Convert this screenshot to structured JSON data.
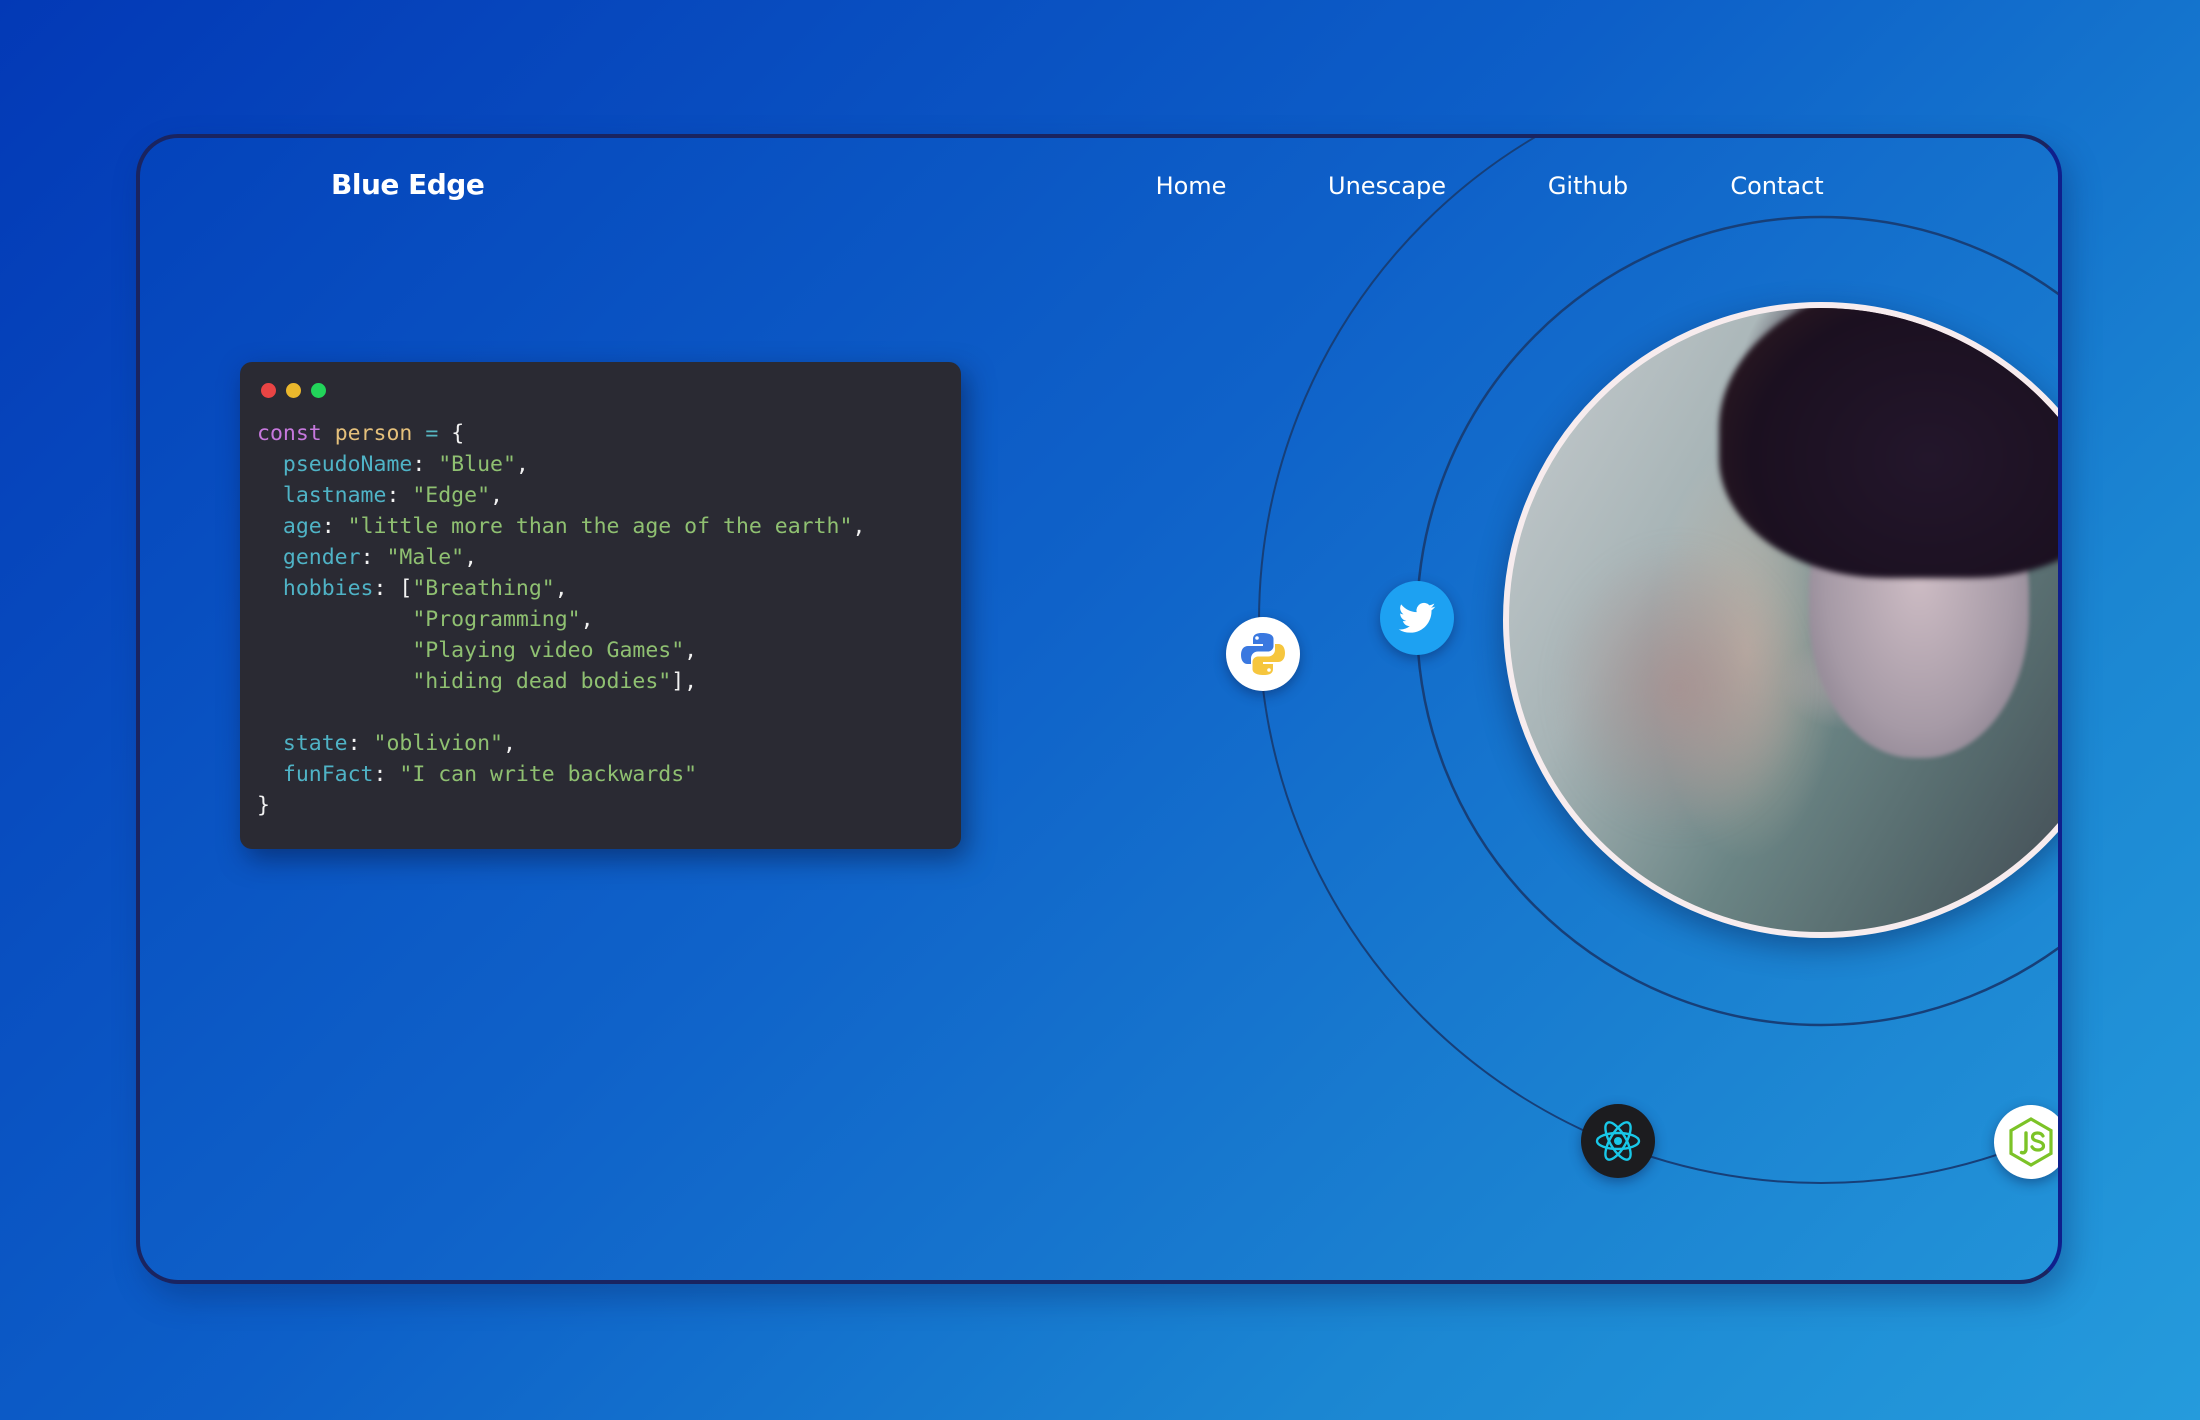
{
  "brand": {
    "name": "Blue Edge"
  },
  "nav": {
    "items": [
      {
        "label": "Home"
      },
      {
        "label": "Unescape"
      },
      {
        "label": "Github"
      },
      {
        "label": "Contact"
      }
    ]
  },
  "code_window": {
    "window_dots": [
      "#e94444",
      "#eab72c",
      "#22d45a"
    ],
    "back_window_dots": [
      "#7a3d82",
      "#77807b",
      "#0e8d87"
    ],
    "declaration": {
      "keyword": "const",
      "name": "person",
      "operator": "=",
      "open": "{"
    },
    "fields": [
      {
        "key": "pseudoName",
        "value": "\"Blue\"",
        "trail": ","
      },
      {
        "key": "lastname",
        "value": "\"Edge\"",
        "trail": ","
      },
      {
        "key": "age",
        "value": "\"little more than the age of the earth\"",
        "trail": ","
      },
      {
        "key": "gender",
        "value": "\"Male\"",
        "trail": ","
      }
    ],
    "hobbies": {
      "key": "hobbies",
      "items": [
        "\"Breathing\"",
        "\"Programming\"",
        "\"Playing video Games\"",
        "\"hiding dead bodies\""
      ]
    },
    "fields_after": [
      {
        "key": "state",
        "value": "\"oblivion\"",
        "trail": ","
      },
      {
        "key": "funFact",
        "value": "\"I can write backwards\"",
        "trail": ""
      }
    ],
    "close": "}"
  },
  "hero": {
    "profile_image_alt": "Profile portrait",
    "skill_icons": [
      {
        "name": "python-icon",
        "label": "Python"
      },
      {
        "name": "twitter-icon",
        "label": "Twitter"
      },
      {
        "name": "react-icon",
        "label": "React"
      },
      {
        "name": "nodejs-icon",
        "label": "Node.js"
      }
    ]
  },
  "colors": {
    "accent_border": "#1a2460",
    "code_bg": "#2a2a33",
    "twitter_blue": "#1da1f2",
    "react_cyan": "#18c8e8",
    "node_green": "#7cc327",
    "python_blue": "#3a78e0",
    "python_yellow": "#f6c63e"
  }
}
